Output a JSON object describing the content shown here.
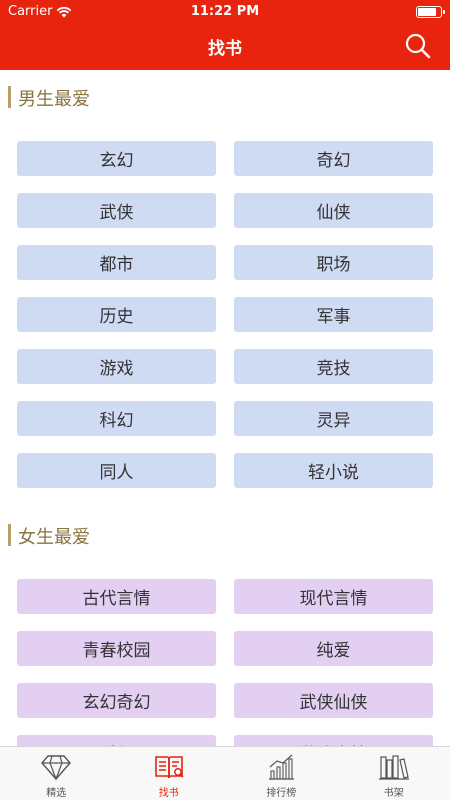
{
  "status_bar": {
    "carrier": "Carrier",
    "time": "11:22 PM",
    "battery_level": 0.85
  },
  "nav": {
    "title": "找书",
    "search_icon": "search-icon"
  },
  "sections": {
    "male": {
      "title": "男生最爱",
      "items": [
        "玄幻",
        "奇幻",
        "武侠",
        "仙侠",
        "都市",
        "职场",
        "历史",
        "军事",
        "游戏",
        "竞技",
        "科幻",
        "灵异",
        "同人",
        "轻小说"
      ]
    },
    "female": {
      "title": "女生最爱",
      "items": [
        "古代言情",
        "现代言情",
        "青春校园",
        "纯爱",
        "玄幻奇幻",
        "武侠仙侠",
        "科幻",
        "游戏竞技"
      ]
    }
  },
  "tabs": [
    {
      "label": "精选",
      "icon": "diamond-icon",
      "active": false
    },
    {
      "label": "找书",
      "icon": "book-search-icon",
      "active": true
    },
    {
      "label": "排行榜",
      "icon": "chart-icon",
      "active": false
    },
    {
      "label": "书架",
      "icon": "bookshelf-icon",
      "active": false
    }
  ],
  "colors": {
    "brand": "#e8230e",
    "male_button": "#cfdaf3",
    "female_button": "#e2cff2",
    "section_title": "#8a7343"
  }
}
